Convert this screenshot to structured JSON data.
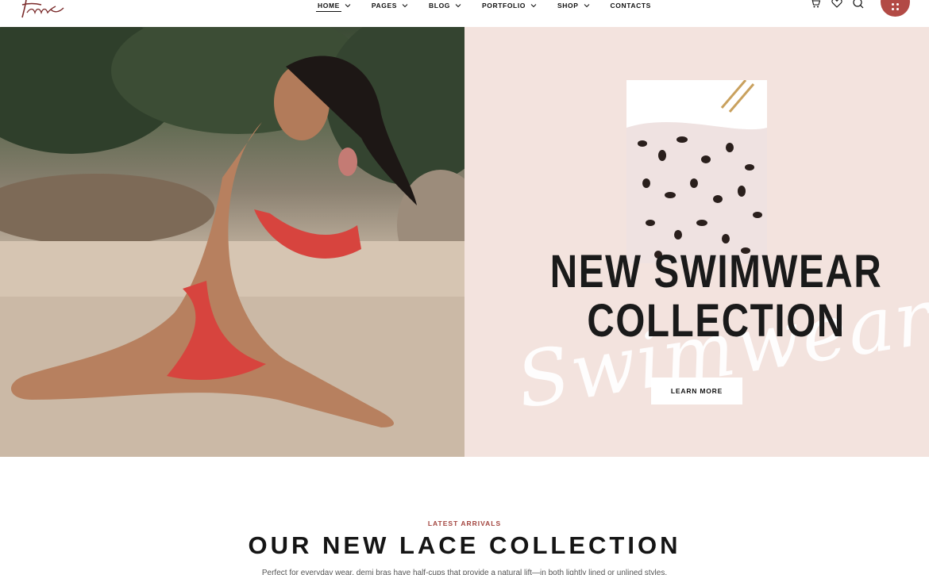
{
  "header": {
    "nav": [
      {
        "label": "HOME",
        "has_dropdown": true,
        "active": true
      },
      {
        "label": "PAGES",
        "has_dropdown": true
      },
      {
        "label": "BLOG",
        "has_dropdown": true
      },
      {
        "label": "PORTFOLIO",
        "has_dropdown": true
      },
      {
        "label": "SHOP",
        "has_dropdown": true
      },
      {
        "label": "CONTACTS",
        "has_dropdown": false
      }
    ],
    "icons": [
      "cart-icon",
      "heart-icon",
      "search-icon",
      "menu-grid-icon"
    ],
    "accent_color": "#b24a45"
  },
  "hero": {
    "title_line1": "NEW SWIMWEAR",
    "title_line2": "COLLECTION",
    "script_word": "Swimwear",
    "button_label": "LEARN MORE",
    "panel_color": "#f3e3de"
  },
  "section": {
    "eyebrow": "LATEST ARRIVALS",
    "title": "OUR NEW LACE COLLECTION",
    "description": "Perfect for everyday wear, demi bras have half-cups that provide a natural lift—in both lightly lined or unlined styles."
  }
}
